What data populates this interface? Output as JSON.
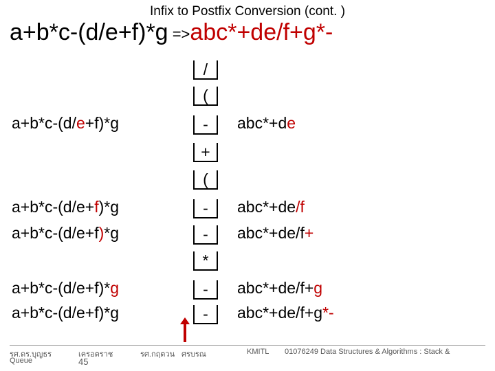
{
  "title": "Infix to Postfix Conversion  (cont. )",
  "headline": {
    "infix": "a+b*c-(d/e+f)*g",
    "arrow": " =>",
    "postfix": "abc*+de/f+g*-"
  },
  "rows": {
    "r1": {
      "stack": "/"
    },
    "r2": {
      "stack": "("
    },
    "r3": {
      "infix_pre": "a+b*c-(d/",
      "infix_hl": "e",
      "infix_post": "+f)*g",
      "stack": "-",
      "queue_pre": "abc*+d",
      "queue_hl": "e"
    },
    "r4": {
      "stack": "+"
    },
    "r5": {
      "stack": "("
    },
    "r6": {
      "infix_pre": "a+b*c-(d/e+",
      "infix_hl": "f",
      "infix_post": ")*g",
      "stack": "-",
      "queue_pre": "abc*+de",
      "queue_hl": "/f"
    },
    "r7": {
      "infix_pre": "a+b*c-(d/e+f",
      "infix_hl": ")",
      "infix_post": "*g",
      "stack": "-",
      "queue_pre": "abc*+de/f",
      "queue_hl": "+"
    },
    "r8": {
      "stack": "*"
    },
    "r9": {
      "infix_pre": "a+b*c-(d/e+f)*",
      "infix_hl": "g",
      "infix_post": "",
      "stack": "-",
      "queue_pre": "abc*+de/f+",
      "queue_hl": "g"
    },
    "r10": {
      "infix_pre": "a+b*c-(d/e+f)*g",
      "infix_hl": "",
      "infix_post": "",
      "stack": "-",
      "queue_pre": "abc*+de/f+g",
      "queue_hl": "*-"
    }
  },
  "footer": {
    "l1": "รศ.ดร.บุญธร",
    "l2": "เครอตราช",
    "m1": "รศ.กฤตวน",
    "m2": "ศรบรณ",
    "r1": "KMITL",
    "r2": "01076249 Data Structures & Algorithms : Stack &",
    "q": "Queue",
    "pg": "45"
  }
}
